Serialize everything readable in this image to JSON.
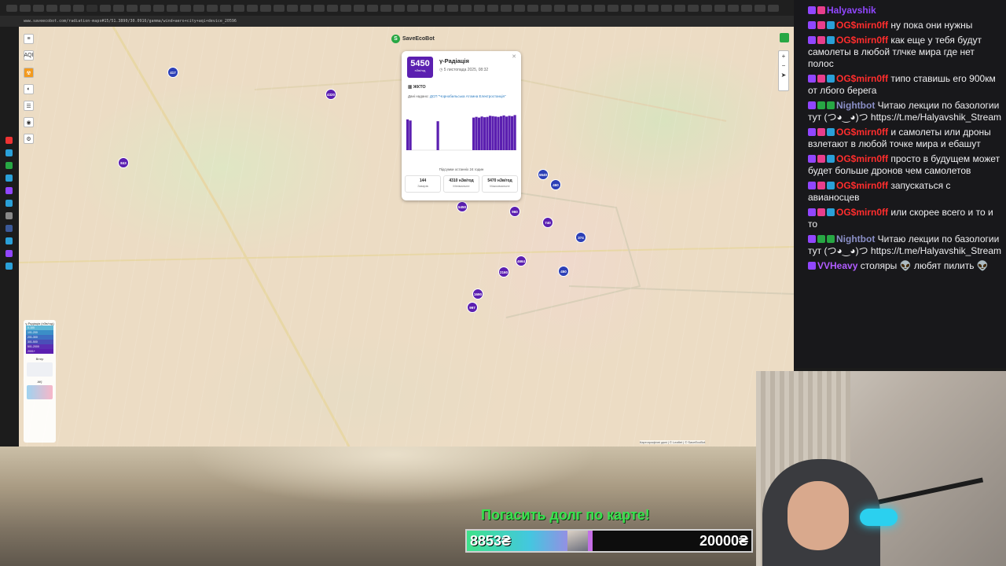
{
  "browser": {
    "url": "www.saveecobot.com/radiation-maps#15/51.3890/30.0916/gamma/wind+aero+city+aqi+device_20596"
  },
  "map": {
    "logo_text": "SaveEcoBot",
    "left_controls": [
      "AQI",
      "☢",
      "◐",
      "☰",
      "◉",
      "⚙"
    ],
    "menu_icon": "menu-icon",
    "zoom_in": "+",
    "zoom_out": "−",
    "markers": [
      {
        "label": "417",
        "color": "blue"
      },
      {
        "label": "4320",
        "color": "purple"
      },
      {
        "label": "843",
        "color": "purple"
      },
      {
        "label": "5540",
        "color": "blue"
      },
      {
        "label": "460",
        "color": "blue"
      },
      {
        "label": "5450",
        "color": "purple"
      },
      {
        "label": "960",
        "color": "purple"
      },
      {
        "label": "740",
        "color": "purple"
      },
      {
        "label": "374",
        "color": "blue"
      },
      {
        "label": "4664",
        "color": "purple"
      },
      {
        "label": "2160",
        "color": "purple"
      },
      {
        "label": "450",
        "color": "blue"
      },
      {
        "label": "1690",
        "color": "purple"
      },
      {
        "label": "997",
        "color": "purple"
      }
    ],
    "popup": {
      "value": "5450",
      "unit": "нЗв/год",
      "title": "γ-Радіація",
      "date": "5 листопада 2025, 08:32",
      "location": "ЖКТО",
      "source_prefix": "Дані надано: ",
      "source_name": "ДСП \"Чорнобильська Атомна Електростанція\"",
      "summary_label": "Підсумки останніх 24 годин",
      "stats": [
        {
          "value": "144",
          "label": "Замірів"
        },
        {
          "value": "4310 нЗв/год",
          "label": "Мінімальне"
        },
        {
          "value": "5470 нЗв/год",
          "label": "Максимальне"
        }
      ],
      "bars": [
        0.85,
        0.82,
        0,
        0,
        0,
        0,
        0,
        0,
        0,
        0,
        0,
        0.8,
        0,
        0,
        0,
        0,
        0,
        0,
        0,
        0,
        0,
        0,
        0,
        0,
        0.9,
        0.92,
        0.9,
        0.93,
        0.91,
        0.92,
        0.95,
        0.94,
        0.93,
        0.92,
        0.94,
        0.96,
        0.93,
        0.95,
        0.94,
        0.97
      ]
    },
    "legend": {
      "title": "γ-Радіація (нЗв/год)",
      "rows": [
        {
          "range": "0-100",
          "color": "#5fb7d6"
        },
        {
          "range": "101-200",
          "color": "#3b8ec7"
        },
        {
          "range": "201-300",
          "color": "#3e6fc2"
        },
        {
          "range": "301-500",
          "color": "#4a4fb8"
        },
        {
          "range": "501-2000",
          "color": "#5b2fb3"
        },
        {
          "range": "2001+",
          "color": "#5b1fb0"
        }
      ],
      "sub1": "Вітер",
      "sub2": "АҚI"
    },
    "attribution": "Картографічні дані | © Leaflet | © SaveEcoBot"
  },
  "overlay": {
    "donate_text": "Погасить долг по карте!",
    "current": "8853₴",
    "goal": "20000₴",
    "progress": 0.443
  },
  "chat": [
    {
      "user": "Halyavshik",
      "color": "#9147ff",
      "badges": [
        "b-sub",
        "b-heart"
      ],
      "text": ""
    },
    {
      "user": "OG$mirn0ff",
      "color": "#ff2d2d",
      "badges": [
        "b-sub",
        "b-heart",
        "b-blue"
      ],
      "text": "ну пока они нужны"
    },
    {
      "user": "OG$mirn0ff",
      "color": "#ff2d2d",
      "badges": [
        "b-sub",
        "b-heart",
        "b-blue"
      ],
      "text": "как еще у тебя будут самолеты в любой тлчке мира где нет полос"
    },
    {
      "user": "OG$mirn0ff",
      "color": "#ff2d2d",
      "badges": [
        "b-sub",
        "b-heart",
        "b-blue"
      ],
      "text": "типо ставишь его 900км от лбого берега"
    },
    {
      "user": "Nightbot",
      "color": "#8a8fc7",
      "badges": [
        "b-sub",
        "b-green",
        "b-green"
      ],
      "text": "Читаю лекции по базологии тут (つ◕‿◕)つ https://t.me/Halyavshik_Stream"
    },
    {
      "user": "OG$mirn0ff",
      "color": "#ff2d2d",
      "badges": [
        "b-sub",
        "b-heart",
        "b-blue"
      ],
      "text": "и самолеты или дроны взлетают в любой точке мира и ебашут"
    },
    {
      "user": "OG$mirn0ff",
      "color": "#ff2d2d",
      "badges": [
        "b-sub",
        "b-heart",
        "b-blue"
      ],
      "text": "просто в будущем может будет больше дронов чем самолетов"
    },
    {
      "user": "OG$mirn0ff",
      "color": "#ff2d2d",
      "badges": [
        "b-sub",
        "b-heart",
        "b-blue"
      ],
      "text": "запускаться с авианосцев"
    },
    {
      "user": "OG$mirn0ff",
      "color": "#ff2d2d",
      "badges": [
        "b-sub",
        "b-heart",
        "b-blue"
      ],
      "text": "или скорее всего и то и то"
    },
    {
      "user": "Nightbot",
      "color": "#8a8fc7",
      "badges": [
        "b-sub",
        "b-green",
        "b-green"
      ],
      "text": "Читаю лекции по базологии тут (つ◕‿◕)つ https://t.me/Halyavshik_Stream"
    },
    {
      "user": "VVHeavy",
      "color": "#b05cff",
      "badges": [
        "b-sub"
      ],
      "text": "столяры 👽 любят пилить 👽"
    }
  ]
}
